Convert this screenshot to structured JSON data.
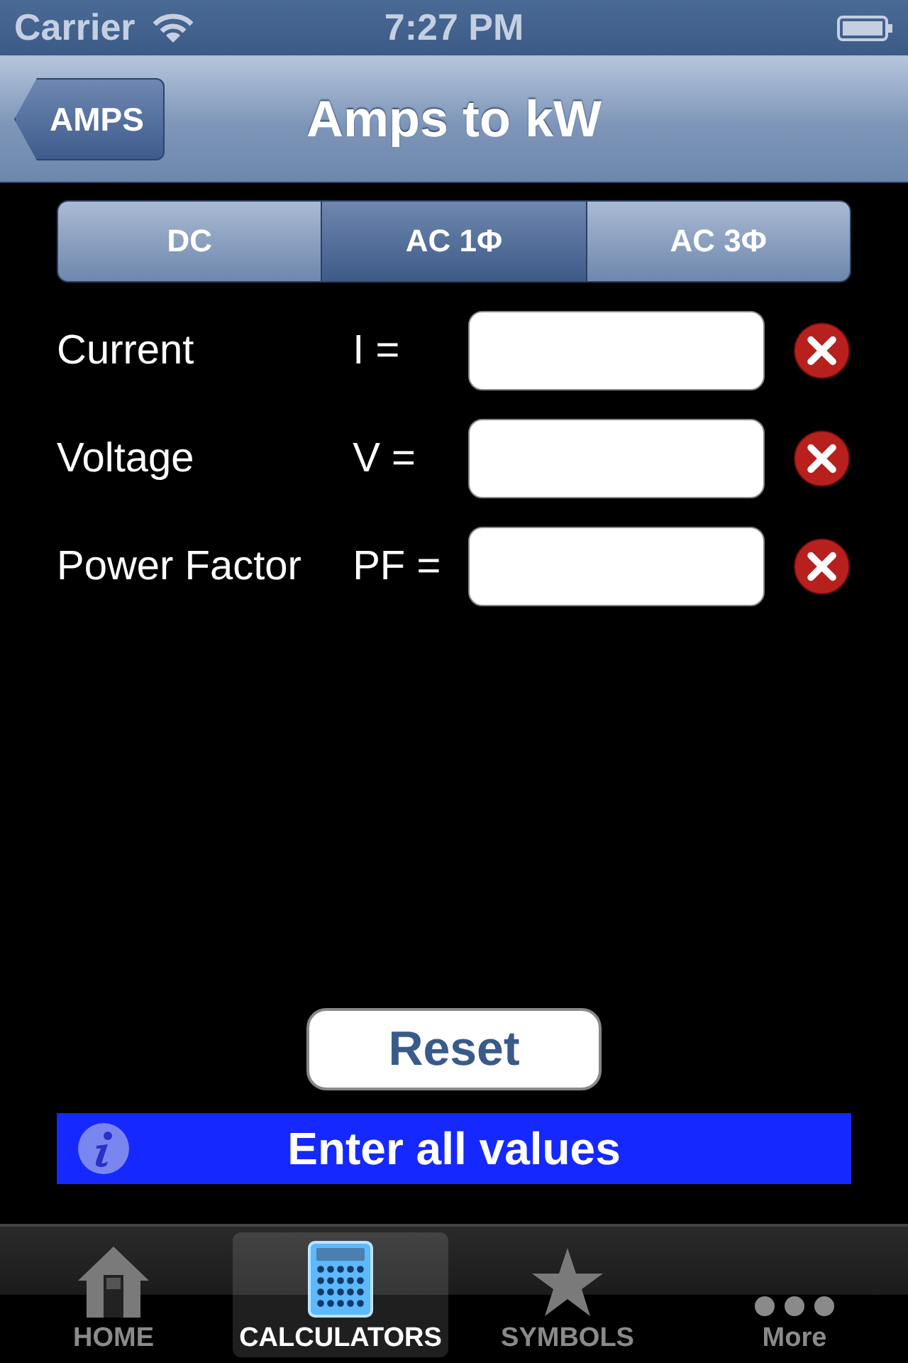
{
  "status_bar": {
    "carrier": "Carrier",
    "time": "7:27 PM"
  },
  "nav": {
    "back": "AMPS",
    "title": "Amps to kW"
  },
  "segments": [
    {
      "label": "DC",
      "selected": false
    },
    {
      "label": "AC 1Φ",
      "selected": true
    },
    {
      "label": "AC 3Φ",
      "selected": false
    }
  ],
  "fields": [
    {
      "label": "Current",
      "symbol": "I ="
    },
    {
      "label": "Voltage",
      "symbol": "V ="
    },
    {
      "label": "Power Factor",
      "symbol": "PF ="
    }
  ],
  "reset": "Reset",
  "message": "Enter all values",
  "tabs": [
    {
      "kind": "home",
      "label": "HOME",
      "selected": false
    },
    {
      "kind": "calculator",
      "label": "CALCULATORS",
      "selected": true
    },
    {
      "kind": "star",
      "label": "SYMBOLS",
      "selected": false
    },
    {
      "kind": "more",
      "label": "More",
      "selected": false
    }
  ]
}
